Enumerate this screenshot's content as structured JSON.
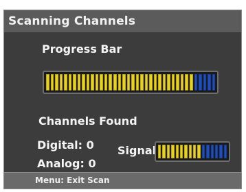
{
  "title": "Scanning Channels",
  "progress": {
    "label": "Progress Bar",
    "fraction": 0.87
  },
  "channels": {
    "label": "Channels Found",
    "digital": "Digital:  0",
    "analog": "Analog:  0"
  },
  "signal": {
    "label": "Signal",
    "fraction": 0.62
  },
  "footer": {
    "hint": "Menu: Exit Scan"
  },
  "colors": {
    "meter_on": "#e8d21c",
    "meter_off": "#1f4fbf",
    "panel_bg": "#3c3c3c"
  }
}
